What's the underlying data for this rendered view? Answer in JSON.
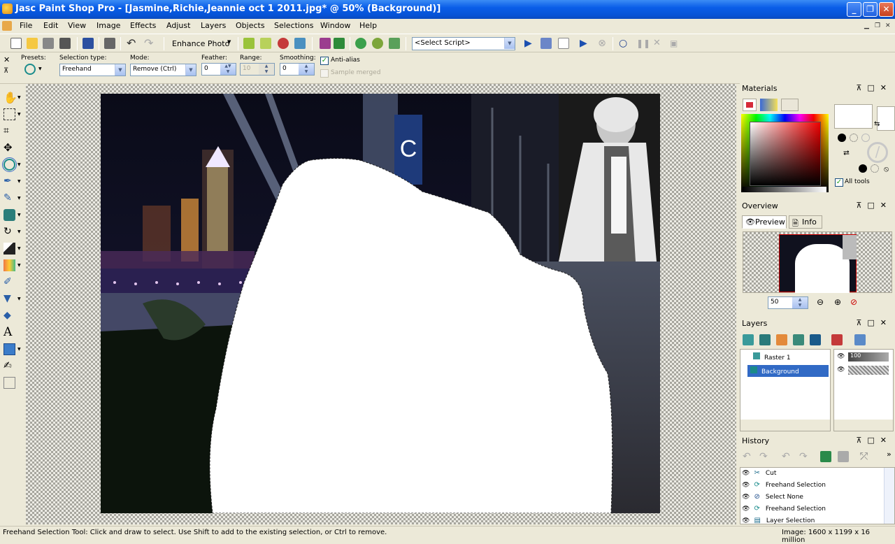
{
  "window": {
    "title": "Jasc Paint Shop Pro - [Jasmine,Richie,Jeannie oct 1 2011.jpg* @  50% (Background)]",
    "buttons": [
      "_",
      "❐",
      "✕"
    ]
  },
  "menu": [
    "File",
    "Edit",
    "View",
    "Image",
    "Effects",
    "Adjust",
    "Layers",
    "Objects",
    "Selections",
    "Window",
    "Help"
  ],
  "toolbar": {
    "enhance_photo": "Enhance Photo",
    "script_select": "<Select Script>"
  },
  "tool_options": {
    "presets_label": "Presets:",
    "selection_type_label": "Selection type:",
    "selection_type_value": "Freehand",
    "mode_label": "Mode:",
    "mode_value": "Remove (Ctrl)",
    "feather_label": "Feather:",
    "feather_value": "0",
    "range_label": "Range:",
    "range_value": "10",
    "smoothing_label": "Smoothing:",
    "smoothing_value": "0",
    "anti_alias_label": "Anti-alias",
    "anti_alias_checked": true,
    "sample_merged_label": "Sample merged",
    "sample_merged_checked": false
  },
  "materials": {
    "title": "Materials",
    "all_tools_label": "All tools",
    "all_tools_checked": true
  },
  "overview": {
    "title": "Overview",
    "tabs": [
      "Preview",
      "Info"
    ],
    "zoom_value": "50"
  },
  "layers": {
    "title": "Layers",
    "items": [
      {
        "name": "Raster 1",
        "opacity": "100",
        "selected": false
      },
      {
        "name": "Background",
        "opacity": "",
        "selected": true
      }
    ]
  },
  "history": {
    "title": "History",
    "items": [
      "Cut",
      "Freehand Selection",
      "Select None",
      "Freehand Selection",
      "Layer Selection"
    ]
  },
  "status": {
    "message": "Freehand Selection Tool: Click and draw to select. Use Shift to add to the existing selection, or Ctrl to remove.",
    "image_info": "Image:  1600 x 1199 x 16 million"
  },
  "colors": {
    "title_bar": "#0a5ee8",
    "chrome": "#ece9d8",
    "selection_highlight": "#316ac5",
    "foreground_swatch": "#ffffff"
  }
}
